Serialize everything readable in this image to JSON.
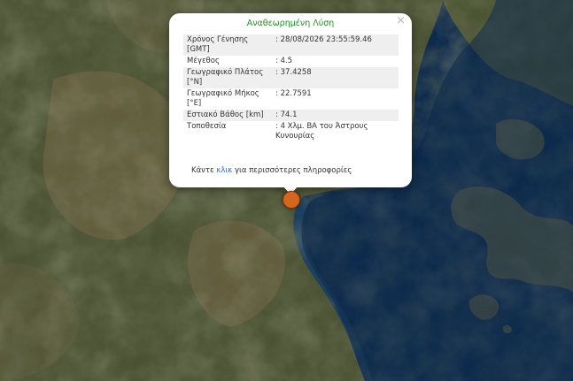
{
  "popup": {
    "title": "Αναθεωρημένη Λύση",
    "close_symbol": "×",
    "rows": [
      {
        "label": "Χρόνος Γένησης [GMT]",
        "value": ": 28/08/2026 23:55:59.46"
      },
      {
        "label": "Μέγεθος",
        "value": ": 4.5"
      },
      {
        "label": "Γεωγραφικό Πλάτος [°N]",
        "value": ": 37.4258"
      },
      {
        "label": "Γεωγραφικό Μήκος [°E]",
        "value": ": 22.7591"
      },
      {
        "label": "Εστιακό Βάθος [km]",
        "value": ": 74.1"
      },
      {
        "label": "Τοποθεσία",
        "value": ": 4 Χλμ. ΒΑ του Άστρους Κυνουρίας"
      }
    ],
    "more_prefix": "Κάντε ",
    "more_link": "κλικ",
    "more_suffix": " για περισσότερες πληροφορίες"
  },
  "map": {
    "marker_color": "#d5661e",
    "sea_color": "#0c2a4d",
    "land_color": "#3f4a2b"
  }
}
